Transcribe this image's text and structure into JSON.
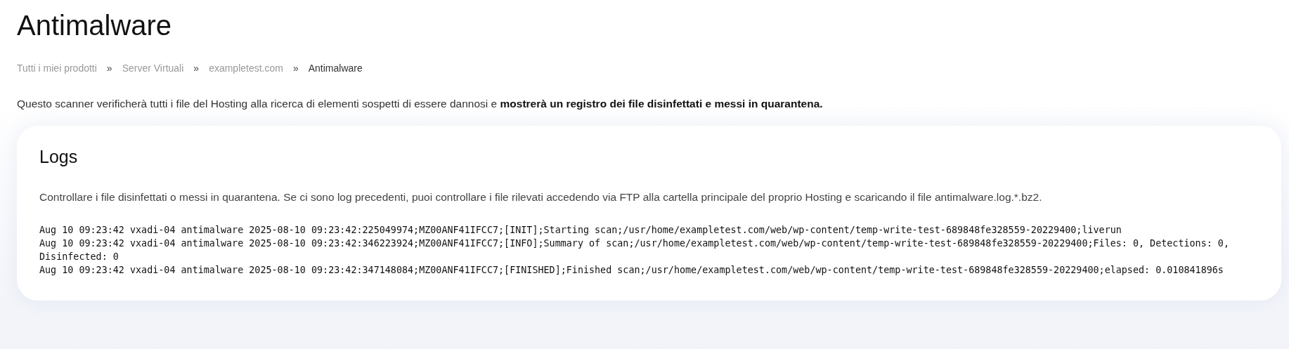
{
  "page_title": "Antimalware",
  "breadcrumb": [
    {
      "label": "Tutti i miei prodotti",
      "current": false
    },
    {
      "label": "Server Virtuali",
      "current": false
    },
    {
      "label": "exampletest.com",
      "current": false
    },
    {
      "label": "Antimalware",
      "current": true
    }
  ],
  "breadcrumb_separator": "»",
  "intro": "Questo scanner verificherà tutti i file del Hosting alla ricerca di elementi sospetti di essere dannosi e **mostrerà un registro dei file disinfettati e messi in quarantena.**",
  "logs_card": {
    "title": "Logs",
    "description": "Controllare i file disinfettati o messi in quarantena. Se ci sono log precedenti, puoi controllare i file rilevati accedendo via FTP alla cartella principale del proprio Hosting e scaricando il file antimalware.log.*.bz2.",
    "log_lines": [
      "Aug 10 09:23:42 vxadi-04 antimalware 2025-08-10 09:23:42:225049974;MZ00ANF41IFCC7;[INIT];Starting scan;/usr/home/exampletest.com/web/wp-content/temp-write-test-689848fe328559-20229400;liverun",
      "Aug 10 09:23:42 vxadi-04 antimalware 2025-08-10 09:23:42:346223924;MZ00ANF41IFCC7;[INFO];Summary of scan;/usr/home/exampletest.com/web/wp-content/temp-write-test-689848fe328559-20229400;Files: 0, Detections: 0, Disinfected: 0",
      "Aug 10 09:23:42 vxadi-04 antimalware 2025-08-10 09:23:42:347148084;MZ00ANF41IFCC7;[FINISHED];Finished scan;/usr/home/exampletest.com/web/wp-content/temp-write-test-689848fe328559-20229400;elapsed: 0.010841896s"
    ]
  }
}
